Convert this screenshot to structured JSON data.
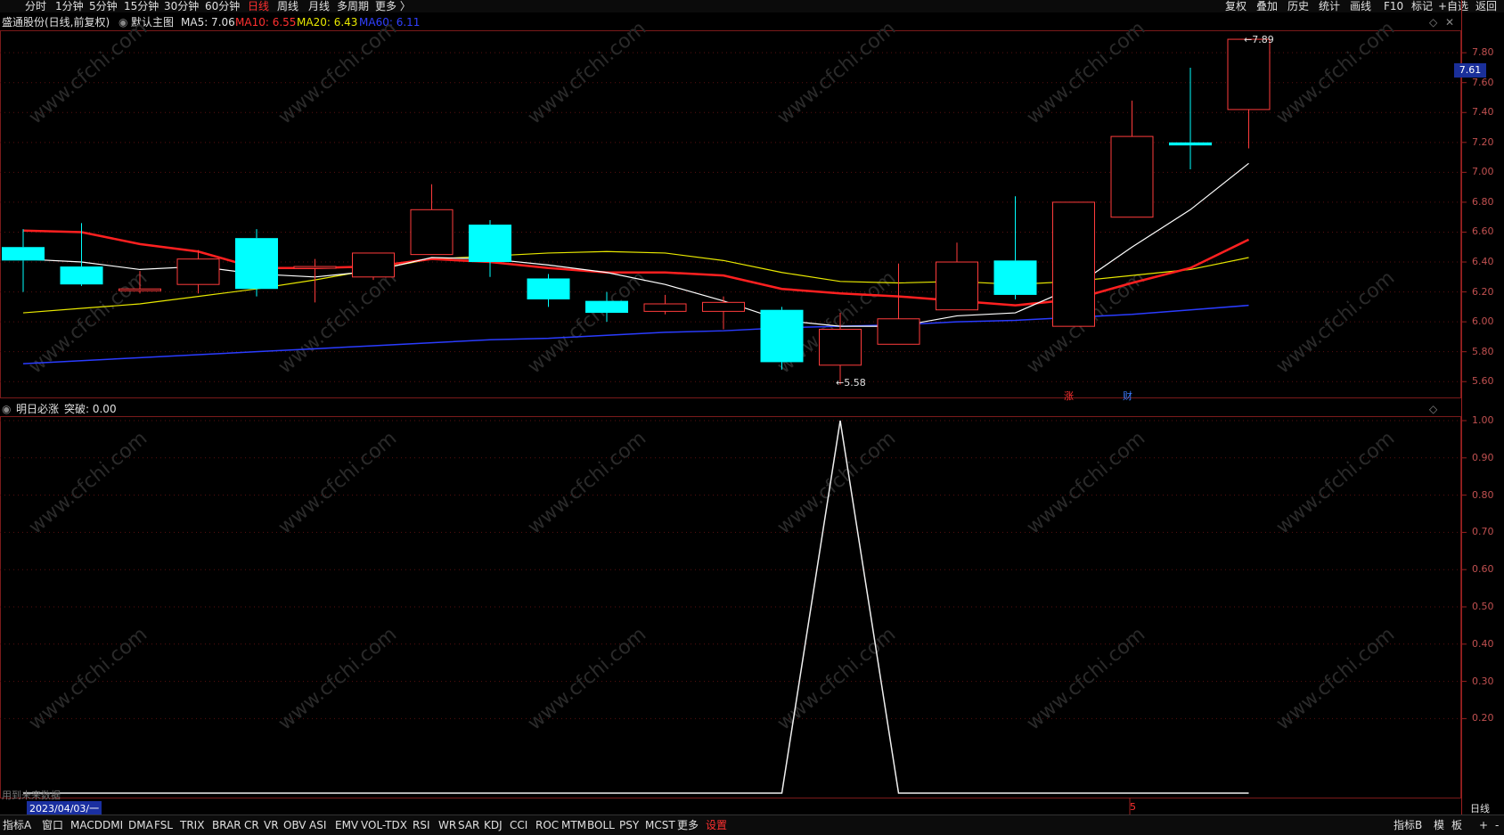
{
  "topbar": {
    "periods": [
      "分时",
      "1分钟",
      "5分钟",
      "15分钟",
      "30分钟",
      "60分钟",
      "日线",
      "周线",
      "月线",
      "多周期",
      "更多 〉"
    ],
    "active_period": "日线",
    "right_buttons": [
      "复权",
      "叠加",
      "历史",
      "统计",
      "画线",
      "F10",
      "标记",
      "+自选",
      "返回"
    ]
  },
  "title": {
    "stock": "盛通股份(日线,前复权)",
    "template": "默认主图",
    "ma5": "MA5: 7.06",
    "ma10": "MA10: 6.55",
    "ma20": "MA20: 6.43",
    "ma60": "MA60: 6.11"
  },
  "indicator": {
    "name": "明日必涨",
    "value": "突破: 0.00"
  },
  "price_axis": {
    "ticks": [
      "7.80",
      "7.60",
      "7.40",
      "7.20",
      "7.00",
      "6.80",
      "6.60",
      "6.40",
      "6.20",
      "6.00",
      "5.80",
      "5.60"
    ],
    "current_price": "7.61"
  },
  "indicator_axis": {
    "ticks": [
      "1.00",
      "0.90",
      "0.80",
      "0.70",
      "0.60",
      "0.50",
      "0.40",
      "0.30",
      "0.20"
    ]
  },
  "annotations": {
    "high": "7.89",
    "low": "5.58",
    "tag_zhang": "涨",
    "tag_cai": "财",
    "future_data": "用到未来数据",
    "date_label": "2023/04/03/一",
    "month_marker": "5",
    "period_label": "日线"
  },
  "bottombar": {
    "tabs": [
      "指标A",
      "窗口",
      "MACD",
      "DMI",
      "DMA",
      "FSL",
      "TRIX",
      "BRAR",
      "CR",
      "VR",
      "OBV",
      "ASI",
      "EMV",
      "VOL-TDX",
      "RSI",
      "WR",
      "SAR",
      "KDJ",
      "CCI",
      "ROC",
      "MTM",
      "BOLL",
      "PSY",
      "MCST",
      "更多",
      "设置"
    ],
    "right": [
      "指标B",
      "模",
      "板",
      "+",
      "-"
    ]
  },
  "watermark": "www.cfchi.com",
  "colors": {
    "up": "#ff3c3c",
    "down": "#00ffff",
    "ma5": "#ffffff",
    "ma10": "#ff2020",
    "ma20": "#e8e800",
    "ma60": "#2a3cff",
    "grid": "#5a1010",
    "axis_text": "#c05050"
  },
  "chart_data": {
    "type": "candlestick",
    "ylim": [
      5.5,
      7.95
    ],
    "candles": [
      {
        "o": 6.5,
        "c": 6.41,
        "h": 6.62,
        "l": 6.2
      },
      {
        "o": 6.37,
        "c": 6.25,
        "h": 6.66,
        "l": 6.24
      },
      {
        "o": 6.21,
        "c": 6.22,
        "h": 6.34,
        "l": 6.19
      },
      {
        "o": 6.25,
        "c": 6.42,
        "h": 6.48,
        "l": 6.19
      },
      {
        "o": 6.56,
        "c": 6.22,
        "h": 6.62,
        "l": 6.17
      },
      {
        "o": 6.36,
        "c": 6.37,
        "h": 6.42,
        "l": 6.13
      },
      {
        "o": 6.3,
        "c": 6.46,
        "h": 6.46,
        "l": 6.28
      },
      {
        "o": 6.45,
        "c": 6.75,
        "h": 6.92,
        "l": 6.45
      },
      {
        "o": 6.65,
        "c": 6.4,
        "h": 6.68,
        "l": 6.3
      },
      {
        "o": 6.29,
        "c": 6.15,
        "h": 6.32,
        "l": 6.1
      },
      {
        "o": 6.14,
        "c": 6.06,
        "h": 6.2,
        "l": 6.0
      },
      {
        "o": 6.07,
        "c": 6.12,
        "h": 6.18,
        "l": 6.05
      },
      {
        "o": 6.07,
        "c": 6.13,
        "h": 6.17,
        "l": 5.95
      },
      {
        "o": 6.08,
        "c": 5.73,
        "h": 6.1,
        "l": 5.68
      },
      {
        "o": 5.71,
        "c": 5.95,
        "h": 6.06,
        "l": 5.58
      },
      {
        "o": 5.85,
        "c": 6.02,
        "h": 6.39,
        "l": 5.85
      },
      {
        "o": 6.08,
        "c": 6.4,
        "h": 6.53,
        "l": 6.08
      },
      {
        "o": 6.41,
        "c": 6.18,
        "h": 6.84,
        "l": 6.15
      },
      {
        "o": 5.97,
        "c": 6.8,
        "h": 6.8,
        "l": 5.97
      },
      {
        "o": 6.7,
        "c": 7.24,
        "h": 7.48,
        "l": 6.7
      },
      {
        "o": 7.2,
        "c": 7.18,
        "h": 7.7,
        "l": 7.02
      },
      {
        "o": 7.42,
        "c": 7.89,
        "h": 7.89,
        "l": 7.16
      }
    ],
    "ma5": [
      6.42,
      6.4,
      6.35,
      6.37,
      6.32,
      6.3,
      6.34,
      6.43,
      6.42,
      6.38,
      6.33,
      6.25,
      6.14,
      6.01,
      5.97,
      5.97,
      6.04,
      6.06,
      6.23,
      6.5,
      6.75,
      7.06
    ],
    "ma10": [
      6.61,
      6.6,
      6.52,
      6.47,
      6.36,
      6.36,
      6.37,
      6.42,
      6.4,
      6.36,
      6.33,
      6.33,
      6.31,
      6.22,
      6.19,
      6.17,
      6.14,
      6.11,
      6.15,
      6.26,
      6.36,
      6.55
    ],
    "ma20": [
      6.06,
      6.09,
      6.12,
      6.17,
      6.22,
      6.28,
      6.35,
      6.42,
      6.44,
      6.46,
      6.47,
      6.46,
      6.41,
      6.33,
      6.27,
      6.26,
      6.27,
      6.25,
      6.27,
      6.31,
      6.35,
      6.43
    ],
    "ma60": [
      5.72,
      5.74,
      5.76,
      5.78,
      5.8,
      5.82,
      5.84,
      5.86,
      5.88,
      5.89,
      5.91,
      5.93,
      5.94,
      5.96,
      5.97,
      5.98,
      6.0,
      6.01,
      6.03,
      6.05,
      6.08,
      6.11
    ],
    "indicator": {
      "ylim": [
        0,
        1.0
      ],
      "values": [
        0,
        0,
        0,
        0,
        0,
        0,
        0,
        0,
        0,
        0,
        0,
        0,
        0,
        0,
        1,
        0,
        0,
        0,
        0,
        0,
        0,
        0
      ]
    }
  }
}
